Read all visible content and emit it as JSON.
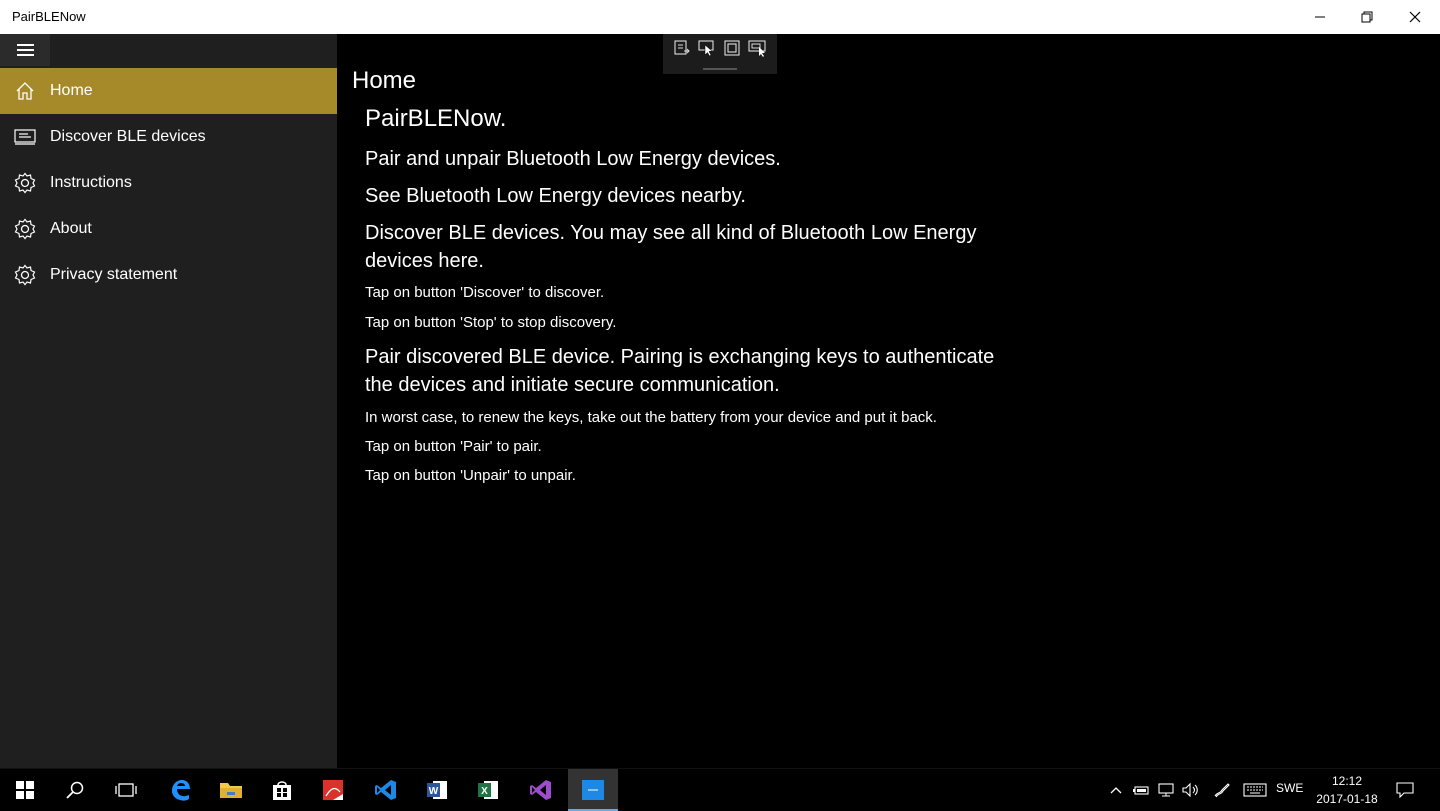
{
  "window": {
    "title": "PairBLENow"
  },
  "sidebar": {
    "items": [
      {
        "label": "Home",
        "icon": "home-icon",
        "active": true
      },
      {
        "label": "Discover BLE devices",
        "icon": "discover-icon",
        "active": false
      },
      {
        "label": "Instructions",
        "icon": "gear-icon",
        "active": false
      },
      {
        "label": "About",
        "icon": "gear-icon",
        "active": false
      },
      {
        "label": "Privacy statement",
        "icon": "gear-icon",
        "active": false
      }
    ]
  },
  "main": {
    "page_title": "Home",
    "app_heading": "PairBLENow.",
    "paragraphs": [
      "Pair and unpair Bluetooth Low Energy devices.",
      "See Bluetooth Low Energy devices nearby.",
      "Discover BLE devices. You may see all kind of Bluetooth Low Energy devices here.",
      "Tap on button 'Discover' to discover.",
      "Tap on button 'Stop' to stop discovery.",
      "Pair discovered BLE device. Pairing is exchanging keys to authenticate the devices and initiate secure communication.",
      "In worst case, to renew the keys, take out the battery from your device and put it back.",
      "Tap on button 'Pair' to pair.",
      "Tap on button 'Unpair' to unpair."
    ]
  },
  "taskbar": {
    "language": "SWE",
    "time": "12:12",
    "date": "2017-01-18"
  },
  "colors": {
    "accent": "#a68a2a",
    "sidebar_bg": "#1f1f1f",
    "main_bg": "#000000"
  }
}
